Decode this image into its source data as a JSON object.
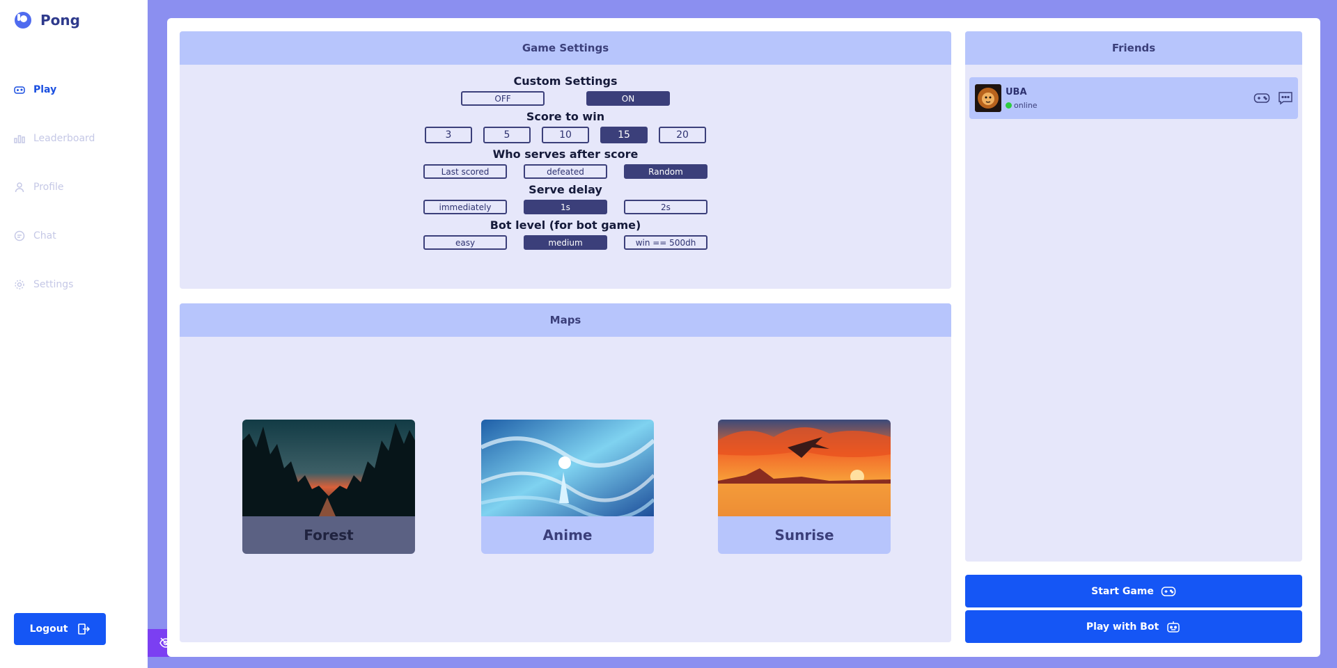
{
  "app": {
    "name": "Pong"
  },
  "sidebar": {
    "items": [
      {
        "label": "Play",
        "icon": "gamepad-icon",
        "active": true
      },
      {
        "label": "Leaderboard",
        "icon": "leaderboard-icon",
        "active": false
      },
      {
        "label": "Profile",
        "icon": "user-icon",
        "active": false
      },
      {
        "label": "Chat",
        "icon": "chat-icon",
        "active": false
      },
      {
        "label": "Settings",
        "icon": "gear-icon",
        "active": false
      }
    ],
    "logout_label": "Logout"
  },
  "settings": {
    "title": "Game Settings",
    "custom": {
      "label": "Custom Settings",
      "options": [
        "OFF",
        "ON"
      ],
      "selected": "ON"
    },
    "score": {
      "label": "Score to win",
      "options": [
        "3",
        "5",
        "10",
        "15",
        "20"
      ],
      "selected": "15"
    },
    "serve_after": {
      "label": "Who serves after score",
      "options": [
        "Last scored",
        "defeated",
        "Random"
      ],
      "selected": "Random"
    },
    "serve_delay": {
      "label": "Serve delay",
      "options": [
        "immediately",
        "1s",
        "2s"
      ],
      "selected": "1s"
    },
    "bot_level": {
      "label": "Bot level (for bot game)",
      "options": [
        "easy",
        "medium",
        "win == 500dh"
      ],
      "selected": "medium"
    }
  },
  "maps": {
    "title": "Maps",
    "items": [
      {
        "name": "Forest",
        "selected": true
      },
      {
        "name": "Anime",
        "selected": false
      },
      {
        "name": "Sunrise",
        "selected": false
      }
    ]
  },
  "friends": {
    "title": "Friends",
    "list": [
      {
        "name": "UBA",
        "status": "online"
      }
    ]
  },
  "actions": {
    "start_label": "Start Game",
    "bot_label": "Play with Bot"
  },
  "colors": {
    "accent": "#1556f5",
    "selected": "#3b3f7a",
    "header": "#b7c5fc",
    "background": "#8b8ff0",
    "online": "#2ecc40"
  }
}
